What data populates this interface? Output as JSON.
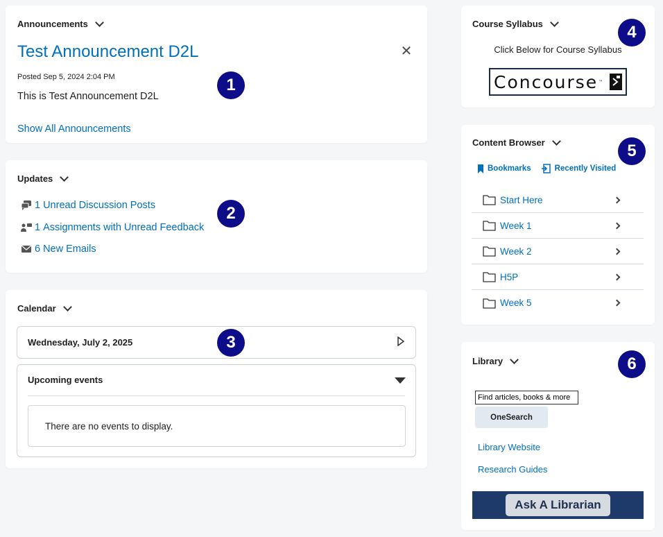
{
  "announcements": {
    "title": "Announcements",
    "headline": "Test Announcement D2L",
    "close_glyph": "✕",
    "posted": "Posted Sep 5, 2024 2:04 PM",
    "body": "This is Test Announcement D2L",
    "show_all": "Show All Announcements",
    "badge": "1"
  },
  "updates": {
    "title": "Updates",
    "badge": "2",
    "items": [
      {
        "count": "1",
        "label": "Unread Discussion Posts",
        "icon": "discussion-icon"
      },
      {
        "count": "1",
        "label": "Assignments with Unread Feedback",
        "icon": "feedback-icon"
      },
      {
        "count": "6",
        "label": "New Emails",
        "icon": "email-icon"
      }
    ]
  },
  "calendar": {
    "title": "Calendar",
    "badge": "3",
    "date": "Wednesday, July 2, 2025",
    "upcoming_title": "Upcoming events",
    "no_events": "There are no events to display."
  },
  "syllabus": {
    "title": "Course Syllabus",
    "badge": "4",
    "text": "Click Below for Course Syllabus",
    "logo_text": "Concourse",
    "logo_tm": "™"
  },
  "content_browser": {
    "title": "Content Browser",
    "badge": "5",
    "tabs": {
      "bookmarks": "Bookmarks",
      "recent": "Recently Visited"
    },
    "items": [
      {
        "label": "Start Here"
      },
      {
        "label": "Week 1"
      },
      {
        "label": "Week 2"
      },
      {
        "label": "H5P"
      },
      {
        "label": "Week 5"
      }
    ]
  },
  "library": {
    "title": "Library",
    "badge": "6",
    "search_value": "Find articles, books & more",
    "button": "OneSearch",
    "links": [
      "Library Website",
      "Research Guides"
    ],
    "banner": "Ask A Librarian"
  },
  "colors": {
    "link": "#006fbf",
    "badge": "#0d0d8a",
    "background": "#f5f6f8"
  }
}
